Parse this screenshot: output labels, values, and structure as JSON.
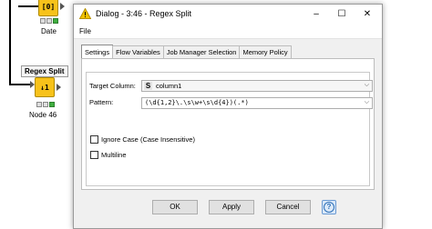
{
  "workflow": {
    "top_node": {
      "icon_text": "[0]",
      "label": "Date"
    },
    "regex_node": {
      "title": "Regex Split",
      "icon_text": "↓1",
      "label": "Node 46"
    }
  },
  "dialog": {
    "title": "Dialog - 3:46 - Regex Split",
    "menu_file": "File",
    "tabs": [
      "Settings",
      "Flow Variables",
      "Job Manager Selection",
      "Memory Policy"
    ],
    "target_column_label": "Target Column:",
    "target_column_type": "S",
    "target_column_value": "column1",
    "pattern_label": "Pattern:",
    "pattern_value": "(\\d{1,2}\\.\\s\\w+\\s\\d{4})(.*)",
    "ignore_case_label": "Ignore Case (Case Insensitive)",
    "multiline_label": "Multiline",
    "ok_label": "OK",
    "apply_label": "Apply",
    "cancel_label": "Cancel",
    "help_label": "?"
  },
  "colors": {
    "node_yellow": "#f7c21a",
    "ok_status": "#3fae3f",
    "help_blue": "#2d6fb8"
  }
}
